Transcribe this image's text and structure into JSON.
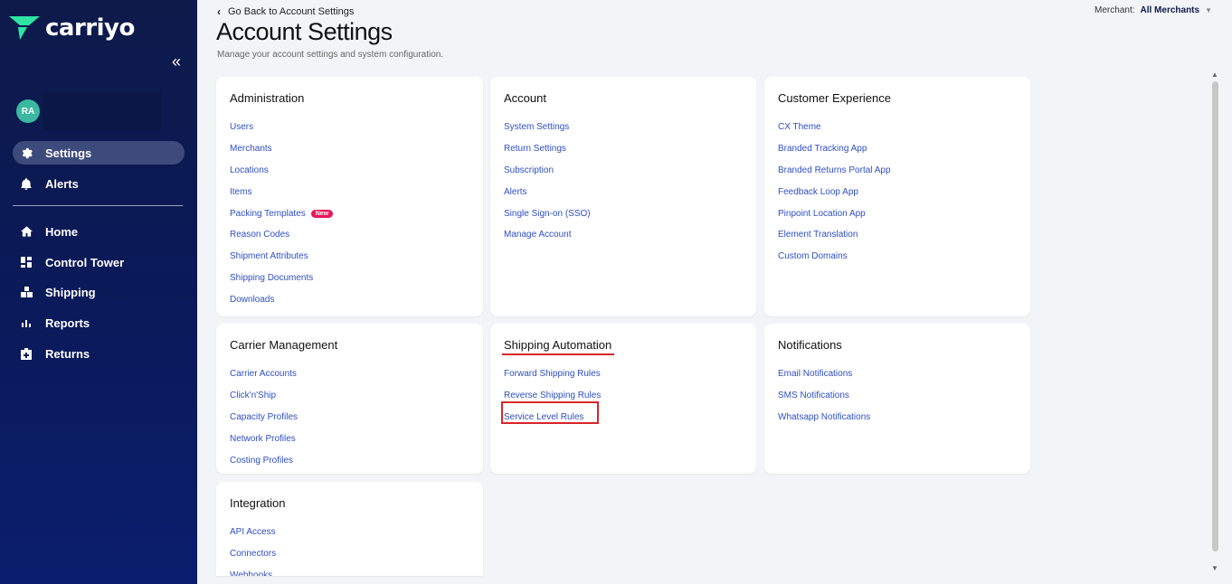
{
  "brand": {
    "name": "carriyo",
    "accent": "#2ee5a3"
  },
  "user": {
    "initials": "RA"
  },
  "nav": {
    "collapse_icon": "double-chevron-left-icon",
    "top": [
      {
        "label": "Settings",
        "icon": "gear-icon",
        "active": true
      },
      {
        "label": "Alerts",
        "icon": "bell-icon",
        "active": false
      }
    ],
    "main": [
      {
        "label": "Home",
        "icon": "home-icon"
      },
      {
        "label": "Control Tower",
        "icon": "dashboard-icon"
      },
      {
        "label": "Shipping",
        "icon": "boxes-icon"
      },
      {
        "label": "Reports",
        "icon": "bar-chart-icon"
      },
      {
        "label": "Returns",
        "icon": "return-box-icon"
      }
    ]
  },
  "header": {
    "back_label": "Go Back to Account Settings",
    "title": "Account Settings",
    "subtitle": "Manage your account settings and system configuration.",
    "merchant_label": "Merchant:",
    "merchant_value": "All Merchants"
  },
  "cards": {
    "administration": {
      "title": "Administration",
      "links": [
        "Users",
        "Merchants",
        "Locations",
        "Items",
        "Packing Templates",
        "Reason Codes",
        "Shipment Attributes",
        "Shipping Documents",
        "Downloads"
      ],
      "badge": "New"
    },
    "account": {
      "title": "Account",
      "links": [
        "System Settings",
        "Return Settings",
        "Subscription",
        "Alerts",
        "Single Sign-on (SSO)",
        "Manage Account"
      ]
    },
    "customer_experience": {
      "title": "Customer Experience",
      "links": [
        "CX Theme",
        "Branded Tracking App",
        "Branded Returns Portal App",
        "Feedback Loop App",
        "Pinpoint Location App",
        "Element Translation",
        "Custom Domains"
      ]
    },
    "carrier_management": {
      "title": "Carrier Management",
      "links": [
        "Carrier Accounts",
        "Click'n'Ship",
        "Capacity Profiles",
        "Network Profiles",
        "Costing Profiles"
      ]
    },
    "shipping_automation": {
      "title": "Shipping Automation",
      "links": [
        "Forward Shipping Rules",
        "Reverse Shipping Rules",
        "Service Level Rules"
      ]
    },
    "notifications": {
      "title": "Notifications",
      "links": [
        "Email Notifications",
        "SMS Notifications",
        "Whatsapp Notifications"
      ]
    },
    "integration": {
      "title": "Integration",
      "links": [
        "API Access",
        "Connectors",
        "Webhooks"
      ]
    }
  },
  "colors": {
    "link": "#2e4fc4",
    "highlight": "#d8262b",
    "sidebar": "#0d1a4a"
  }
}
